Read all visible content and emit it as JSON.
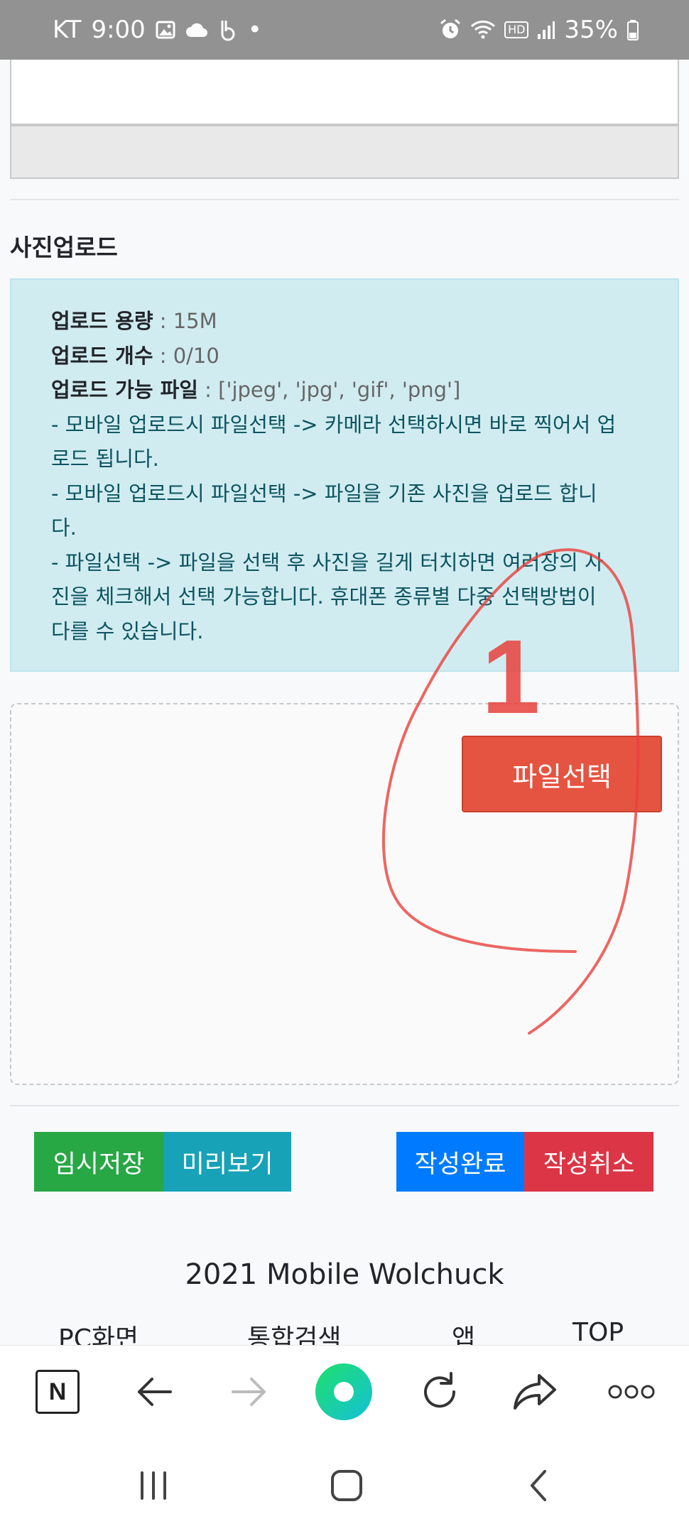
{
  "status_bar": {
    "carrier": "KT",
    "time": "9:00",
    "dot": "•",
    "hd": "HD",
    "battery": "35%",
    "icons": [
      "image-icon",
      "cloud-icon",
      "b-app-icon",
      "alarm-icon",
      "wifi-icon",
      "signal-icon",
      "battery-icon"
    ]
  },
  "upload": {
    "title": "사진업로드",
    "capacity_label": "업로드 용량",
    "capacity_value": ": 15M",
    "count_label": "업로드 개수",
    "count_value": ": 0/10",
    "types_label": "업로드 가능 파일",
    "types_value": ": ['jpeg', 'jpg', 'gif', 'png']",
    "notes": [
      "- 모바일 업로드시 파일선택 -> 카메라 선택하시면 바로 찍어서 업",
      "로드 됩니다.",
      "- 모바일 업로드시 파일선택 -> 파일을 기존 사진을 업로드 합니",
      "다.",
      "- 파일선택 -> 파일을 선택 후 사진을 길게 터치하면 여러장의 사",
      "진을 체크해서 선택 가능합니다. 휴대폰 종류별 다중 선택방법이",
      "다를 수 있습니다."
    ],
    "file_button": "파일선택"
  },
  "annotation": {
    "number": "1",
    "color": "#e8413c"
  },
  "actions": {
    "temp_save": "임시저장",
    "preview": "미리보기",
    "submit": "작성완료",
    "cancel": "작성취소"
  },
  "footer": {
    "title": "2021 Mobile Wolchuck",
    "links": [
      "PC화면",
      "통합검색",
      "앱",
      "TOP"
    ]
  },
  "browser_toolbar": {
    "icons": [
      "naver-n-icon",
      "back-arrow-icon",
      "forward-arrow-icon",
      "green-dot-icon",
      "refresh-icon",
      "share-icon",
      "more-icon"
    ],
    "n_letter": "N"
  },
  "system_nav": {
    "icons": [
      "recent-apps-icon",
      "home-icon",
      "back-icon"
    ]
  },
  "colors": {
    "green": "#28a745",
    "teal": "#17a2b8",
    "blue": "#007bff",
    "red": "#dc3545",
    "file_button": "#e55441",
    "info_bg": "#d1ecf1"
  }
}
